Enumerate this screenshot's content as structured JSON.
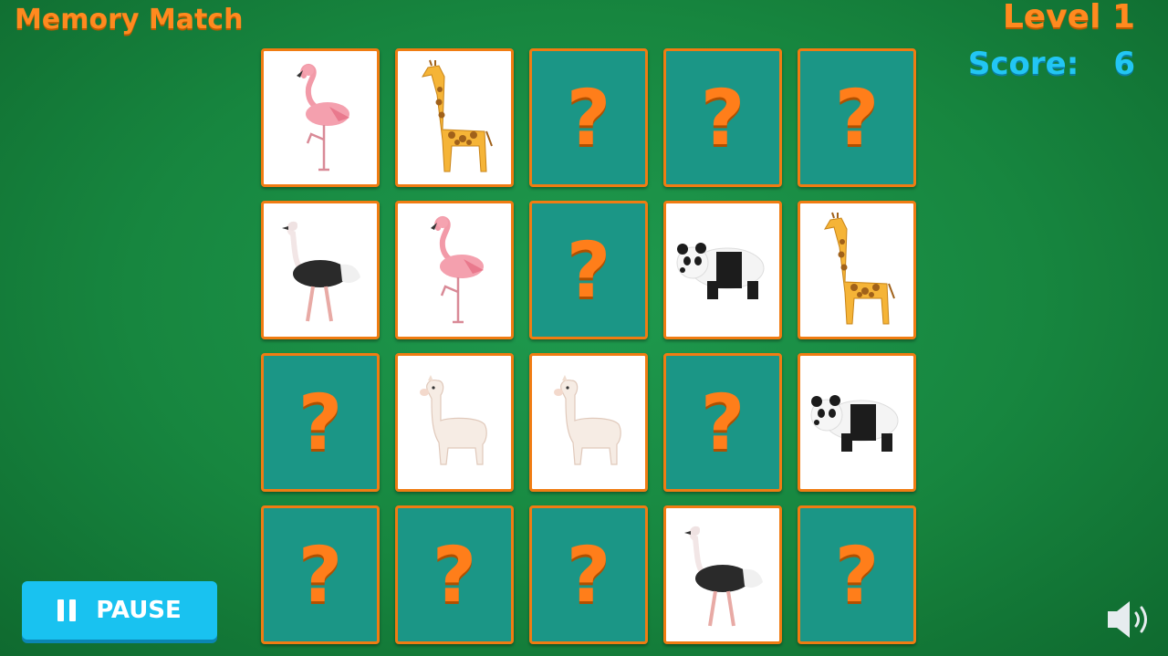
{
  "header": {
    "title": "Memory Match",
    "level_label": "Level 1",
    "score_label": "Score:",
    "score_value": "6"
  },
  "board": {
    "back_symbol": "?",
    "cards": [
      "flamingo",
      "giraffe",
      "hidden",
      "hidden",
      "hidden",
      "ostrich",
      "flamingo",
      "hidden",
      "panda",
      "giraffe",
      "hidden",
      "llama",
      "llama",
      "hidden",
      "panda",
      "hidden",
      "hidden",
      "hidden",
      "ostrich",
      "hidden"
    ]
  },
  "controls": {
    "pause_label": "PAUSE",
    "pause_icon": "pause-icon",
    "sound_icon": "speaker-icon"
  },
  "colors": {
    "accent_orange": "#ff8a1f",
    "score_blue": "#22c6f4",
    "card_back": "#1b9686",
    "background_green": "#1a8f45"
  }
}
